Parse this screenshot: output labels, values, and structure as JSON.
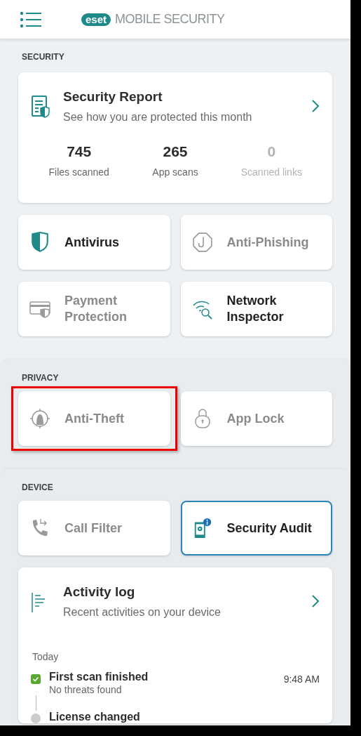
{
  "header": {
    "brand_badge": "eset",
    "brand_text": "MOBILE SECURITY"
  },
  "sections": [
    {
      "title": "SECURITY",
      "report": {
        "title": "Security Report",
        "subtitle": "See how you are protected this month",
        "stats": [
          {
            "value": "745",
            "label": "Files scanned",
            "dim": false
          },
          {
            "value": "265",
            "label": "App scans",
            "dim": false
          },
          {
            "value": "0",
            "label": "Scanned links",
            "dim": true
          }
        ]
      },
      "tiles": [
        {
          "kind": "shield",
          "label": "Antivirus",
          "active": true,
          "focused": false,
          "highlighted": false
        },
        {
          "kind": "hook",
          "label": "Anti-Phishing",
          "active": false,
          "focused": false,
          "highlighted": false
        },
        {
          "kind": "card",
          "label": "Payment Protection",
          "active": false,
          "focused": false,
          "highlighted": false
        },
        {
          "kind": "wifi",
          "label": "Network Inspector",
          "active": true,
          "focused": false,
          "highlighted": false
        }
      ]
    },
    {
      "title": "PRIVACY",
      "tiles": [
        {
          "kind": "thief",
          "label": "Anti-Theft",
          "active": false,
          "focused": false,
          "highlighted": true
        },
        {
          "kind": "lock",
          "label": "App Lock",
          "active": false,
          "focused": false,
          "highlighted": false
        }
      ]
    },
    {
      "title": "DEVICE",
      "tiles": [
        {
          "kind": "phone",
          "label": "Call Filter",
          "active": false,
          "focused": false,
          "highlighted": false
        },
        {
          "kind": "audit",
          "label": "Security Audit",
          "active": true,
          "focused": true,
          "highlighted": false
        }
      ],
      "log": {
        "title": "Activity log",
        "subtitle": "Recent activities on your device",
        "day": "Today",
        "items": [
          {
            "title": "First scan finished",
            "detail": "No threats found",
            "time": "9:48 AM",
            "done": true
          },
          {
            "title": "License changed",
            "done": false
          }
        ]
      }
    }
  ]
}
